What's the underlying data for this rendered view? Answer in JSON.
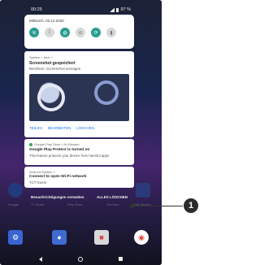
{
  "status": {
    "time": "00:25",
    "battery": "97 %"
  },
  "shade": {
    "date": "Mittwoch, 02.12.2020",
    "tiles": [
      {
        "name": "wifi-icon",
        "glyph": "≋",
        "on": true
      },
      {
        "name": "bluetooth-icon",
        "glyph": "ᛒ",
        "on": false
      },
      {
        "name": "do-not-disturb-icon",
        "glyph": "◍",
        "on": true
      },
      {
        "name": "dnd-minus-icon",
        "glyph": "⊖",
        "on": false
      },
      {
        "name": "rotate-icon",
        "glyph": "⟳",
        "on": true
      },
      {
        "name": "battery-saver-icon",
        "glyph": "▮",
        "on": false
      }
    ]
  },
  "notifications": {
    "screenshot": {
      "header": "System • Jetzt ˅",
      "title": "Screenshot gespeichert",
      "subtitle": "Berühren: Screenshot anzeigen",
      "actions": [
        "TEILEN",
        "BEARBEITEN",
        "LÖSCHEN"
      ]
    },
    "play_protect": {
      "header": "Google Play Store • 2s Minuten",
      "title": "Google Play Protect is turned on",
      "subtitle": "This feature protects your device from harmful apps"
    },
    "wifi": {
      "header": "Android-System ˅",
      "title": "Connect to open Wi-Fi network",
      "subtitle": "TCT-Guest"
    }
  },
  "bottom_actions": {
    "manage": "Benachrichtigungen verwalten",
    "clear_all": "ALLES LÖSCHEN"
  },
  "background_apps": [
    "Google",
    "YT Music",
    "Play Store",
    "YouTube",
    "Play Movies"
  ],
  "callout": {
    "number": "1"
  }
}
